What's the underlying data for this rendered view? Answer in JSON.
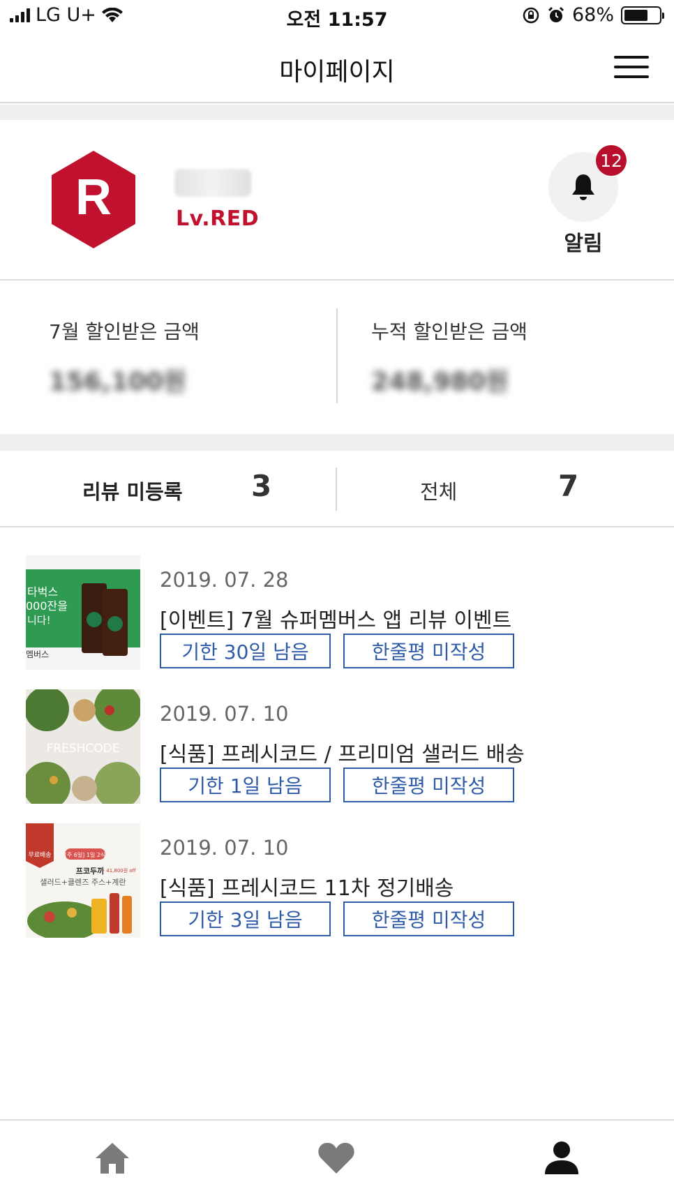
{
  "status_bar": {
    "carrier": "LG U+",
    "time": "오전 11:57",
    "battery": "68%",
    "battery_level": 0.68
  },
  "header": {
    "title": "마이페이지",
    "menu_icon": "hamburger-menu-icon"
  },
  "profile": {
    "grade_letter": "R",
    "level": "Lv.RED",
    "notification_count": "12",
    "notification_label": "알림",
    "colors": {
      "grade": "#c0122f",
      "badge": "#b8102c"
    }
  },
  "savings": {
    "month_label": "7월 할인받은 금액",
    "month_value": "156,100원",
    "total_label": "누적 할인받은 금액",
    "total_value": "248,980원"
  },
  "review_tabs": {
    "pending_label": "리뷰 미등록",
    "pending_count": "3",
    "all_label": "전체",
    "all_count": "7"
  },
  "items": [
    {
      "date": "2019. 07. 28",
      "title": "[이벤트] 7월 슈퍼멤버스 앱 리뷰 이벤트",
      "deadline": "기한 30일 남음",
      "status": "한줄평 미작성",
      "thumb_text": [
        "타벅스",
        "000잔을",
        "니다!",
        "멤버스"
      ]
    },
    {
      "date": "2019. 07. 10",
      "title": "[식품] 프레시코드 / 프리미엄 샐러드 배송",
      "deadline": "기한 1일 남음",
      "status": "한줄평 미작성",
      "thumb_text": [
        "FRESHCODE"
      ]
    },
    {
      "date": "2019. 07. 10",
      "title": "[식품] 프레시코드 11차 정기배송",
      "deadline": "기한 3일 남음",
      "status": "한줄평 미작성",
      "thumb_text": [
        "무료배송",
        "[주 6일] 1일 2식",
        "프코두끼",
        "- 41,800원 off",
        "샐러드+클렌즈 주스+계란"
      ]
    }
  ],
  "bottom_nav": {
    "icons": [
      "home-icon",
      "heart-icon",
      "person-icon"
    ],
    "active": "person-icon"
  }
}
